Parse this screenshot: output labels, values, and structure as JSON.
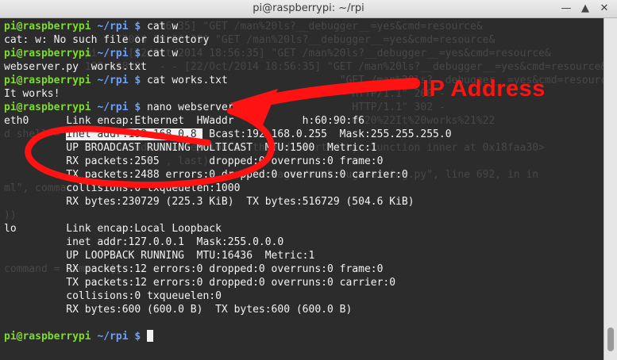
{
  "window": {
    "title": "pi@raspberrypi: ~/rpi",
    "minimize_glyph": "—",
    "maximize_glyph": "▲",
    "close_glyph": "✕"
  },
  "terminal": {
    "prompt_user": "pi@raspberrypi",
    "prompt_path": " ~/rpi $ ",
    "lines": [
      {
        "type": "cmd",
        "text": "cat w"
      },
      {
        "type": "out",
        "text": "cat: w: No such file or directory"
      },
      {
        "type": "cmd",
        "text": "cat w"
      },
      {
        "type": "out",
        "text": "webserver.py  works.txt"
      },
      {
        "type": "cmd",
        "text": "cat works.txt"
      },
      {
        "type": "out",
        "text": "It works!"
      },
      {
        "type": "cmd",
        "text": "nano webserver.p"
      },
      {
        "type": "out",
        "text": "eth0      Link encap:Ethernet  HWaddr           h:60:90:f6"
      },
      {
        "type": "hl",
        "pre": "          ",
        "hl": "inet addr:192.168.0.8 ",
        "post": " Bcast:192.168.0.255  Mask:255.255.255.0"
      },
      {
        "type": "out",
        "text": "          UP BROADCAST RUNNING MULTICAST  MTU:1500  Metric:1"
      },
      {
        "type": "out",
        "text": "          RX packets:2505        dropped:0 overruns:0 frame:0"
      },
      {
        "type": "out",
        "text": "          TX packets:2488 errors:0 dropped:0 overruns:0 carrier:0"
      },
      {
        "type": "out",
        "text": "          collisions:0 txqueuelen:1000"
      },
      {
        "type": "out",
        "text": "          RX bytes:230729 (225.3 KiB)  TX bytes:516729 (504.6 KiB)"
      },
      {
        "type": "out",
        "text": ""
      },
      {
        "type": "out",
        "text": "lo        Link encap:Local Loopback"
      },
      {
        "type": "out",
        "text": "          inet addr:127.0.0.1  Mask:255.0.0.0"
      },
      {
        "type": "out",
        "text": "          UP LOOPBACK RUNNING  MTU:16436  Metric:1"
      },
      {
        "type": "out",
        "text": "          RX packets:12 errors:0 dropped:0 overruns:0 frame:0"
      },
      {
        "type": "out",
        "text": "          TX packets:12 errors:0 dropped:0 overruns:0 carrier:0"
      },
      {
        "type": "out",
        "text": "          collisions:0 txqueuelen:0"
      },
      {
        "type": "out",
        "text": "          RX bytes:600 (600.0 B)  TX bytes:600 (600.0 B)"
      },
      {
        "type": "out",
        "text": ""
      },
      {
        "type": "cmd_cursor",
        "text": ""
      }
    ],
    "background_lines": [
      "                        :56:35] \"GET /man%20ls?__debugger__=yes&cmd=resource&",
      "                  /2014 18:56:35] \"GET /man%20ls?__debugger__=yes&cmd=resource&",
      "             pi - - [22/Oct/2014 18:56:35] \"GET /man%20ls?__debugger__=yes&cmd=resource&",
      "             192.168.0.  - - [22/Oct/2014 18:56:35] \"GET /man%20ls?__debugger__=yes&cmd=resource&",
      "                                                      \"GET /man%20ls?__debugger__=yes&cmd=resource&",
      "                                                        HTTP/1.1\" 200 -",
      "                                                        HTTP/1.1\" 302 -",
      "                                                        o%20%22It%20works%21%22",
      "d shell =",
      "                 Unhandled exception in thread started by <function inner at 0x18faa30>",
      "                          , last):",
      "                                         ackages/werkzeug/serving.py\", line 692, in in",
      "ml\", comma",
      "",
      "))",
      "",
      "",
      "",
      "command = command[]"
    ],
    "annotation_label": "IP Address"
  },
  "colors": {
    "terminal_bg": "#2c2c2c",
    "prompt": "#7ddc2a",
    "path": "#6aa0ff",
    "annotation": "#ff1212"
  }
}
